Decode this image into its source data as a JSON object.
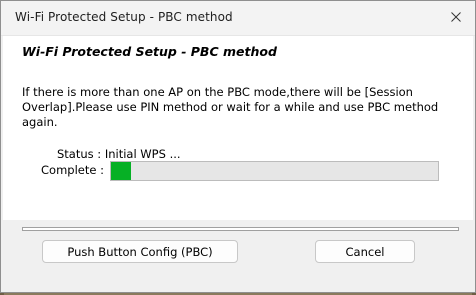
{
  "window": {
    "title": "Wi-Fi Protected Setup - PBC method",
    "close_icon": "close-icon"
  },
  "content": {
    "heading": "Wi-Fi Protected Setup - PBC method",
    "message_line1": "If there is more than one AP on the PBC mode,there will be [Session",
    "message_line2": "Overlap].Please use PIN method or wait for a while and use PBC method again.",
    "status_text": "Status : Initial WPS ...",
    "complete_label": "Complete :",
    "progress_fraction": 0.06,
    "progress_color": "#06b025"
  },
  "buttons": {
    "pbc_label": "Push Button Config (PBC)",
    "cancel_label": "Cancel"
  }
}
